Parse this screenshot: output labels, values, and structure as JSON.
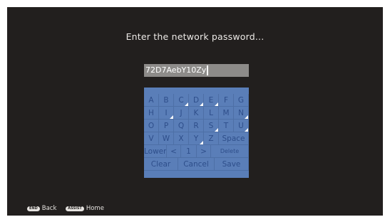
{
  "title": "Enter the network password...",
  "password": {
    "value": "72D7AebY10Zy"
  },
  "keyboard": {
    "rows": [
      [
        {
          "label": "A"
        },
        {
          "label": "B"
        },
        {
          "label": "C",
          "mark": true
        },
        {
          "label": "D",
          "mark": true
        },
        {
          "label": "E",
          "mark": true
        },
        {
          "label": "F"
        },
        {
          "label": "G"
        }
      ],
      [
        {
          "label": "H"
        },
        {
          "label": "I",
          "mark": true
        },
        {
          "label": "J"
        },
        {
          "label": "K"
        },
        {
          "label": "L"
        },
        {
          "label": "M"
        },
        {
          "label": "N",
          "mark": true
        }
      ],
      [
        {
          "label": "O"
        },
        {
          "label": "P"
        },
        {
          "label": "Q"
        },
        {
          "label": "R"
        },
        {
          "label": "S",
          "mark": true
        },
        {
          "label": "T"
        },
        {
          "label": "U",
          "mark": true
        }
      ],
      [
        {
          "label": "V"
        },
        {
          "label": "W"
        },
        {
          "label": "X"
        },
        {
          "label": "Y",
          "mark": true
        },
        {
          "label": "Z"
        },
        {
          "label": "Space"
        }
      ],
      [
        {
          "label": "Lower"
        },
        {
          "label": "<"
        },
        {
          "label": "1"
        },
        {
          "label": ">"
        },
        {
          "label": "Delete"
        }
      ],
      [
        {
          "label": "Clear"
        },
        {
          "label": "Cancel"
        },
        {
          "label": "Save"
        }
      ]
    ]
  },
  "footer": {
    "back": {
      "badge": "END",
      "label": "Back"
    },
    "home": {
      "badge": "ASSIST",
      "label": "Home"
    }
  }
}
